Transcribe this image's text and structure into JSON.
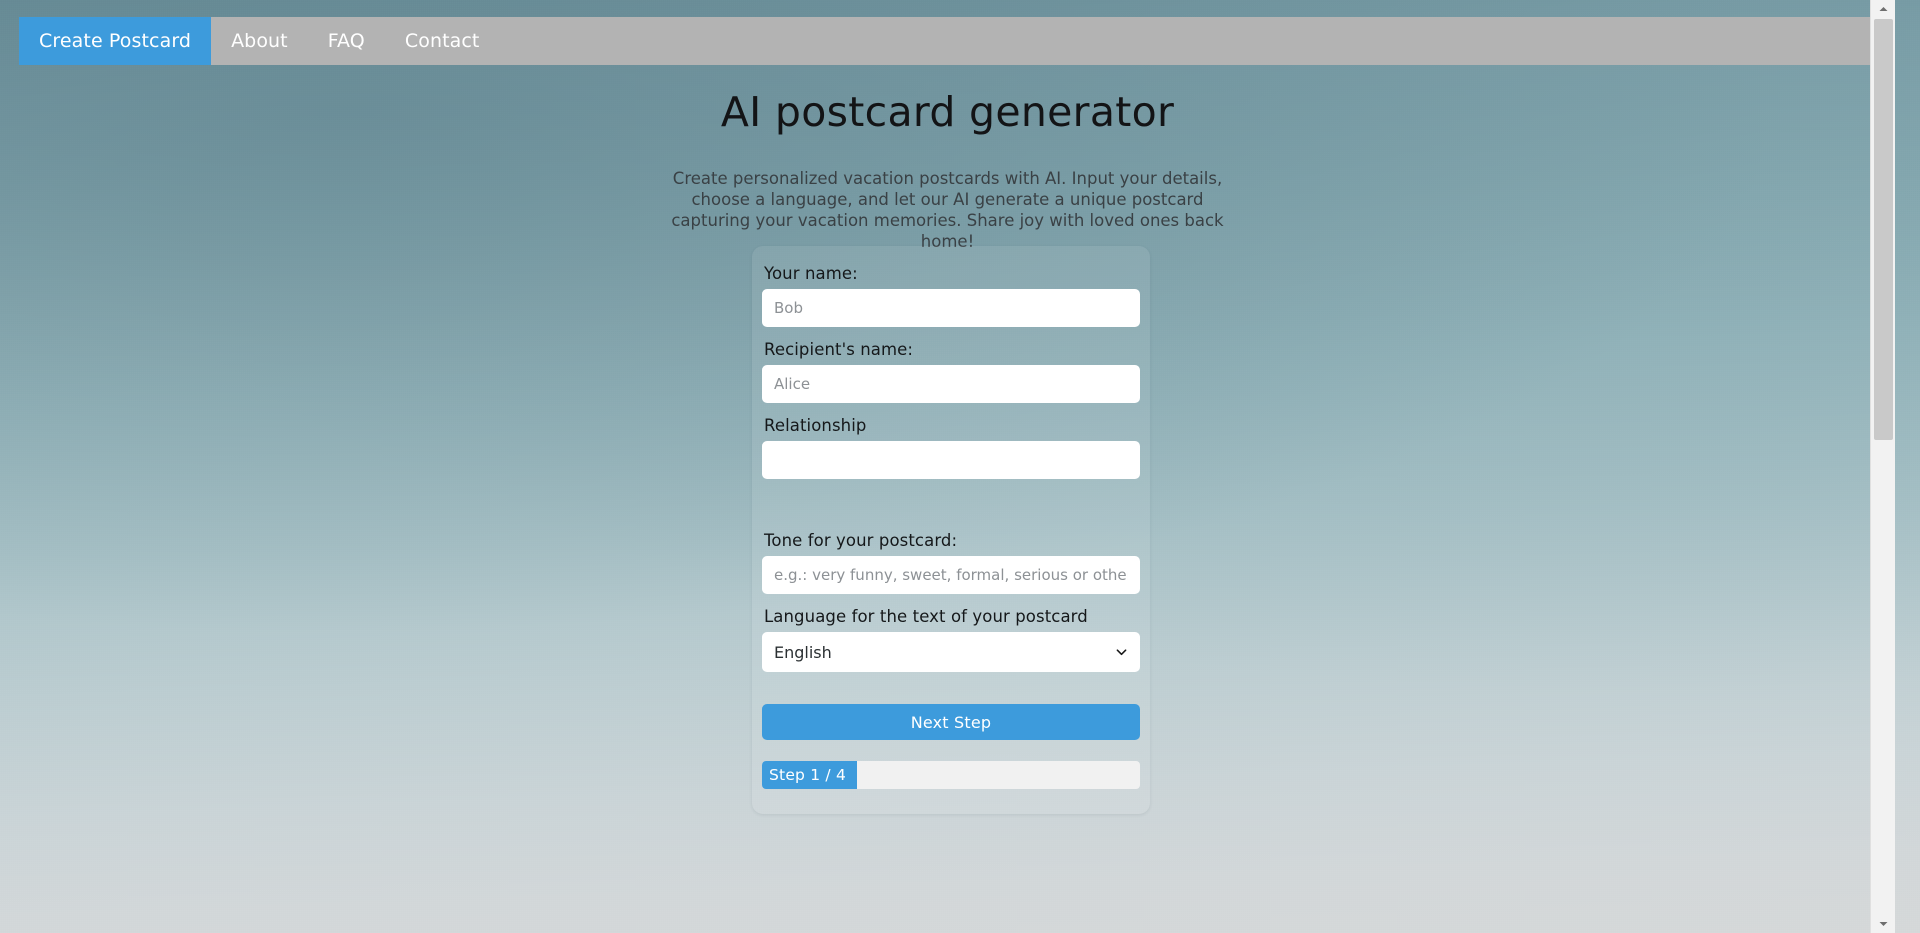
{
  "nav": {
    "items": [
      {
        "label": "Create Postcard",
        "active": true
      },
      {
        "label": "About",
        "active": false
      },
      {
        "label": "FAQ",
        "active": false
      },
      {
        "label": "Contact",
        "active": false
      }
    ]
  },
  "hero": {
    "title": "AI postcard generator",
    "subtitle": "Create personalized vacation postcards with AI. Input your details, choose a language, and let our AI generate a unique postcard capturing your vacation memories. Share joy with loved ones back home!"
  },
  "form": {
    "your_name": {
      "label": "Your name:",
      "value": "",
      "placeholder": "Bob"
    },
    "recipient_name": {
      "label": "Recipient's name:",
      "value": "",
      "placeholder": "Alice"
    },
    "relationship": {
      "label": "Relationship",
      "value": "",
      "placeholder": ""
    },
    "tone": {
      "label": "Tone for your postcard:",
      "value": "",
      "placeholder": "e.g.: very funny, sweet, formal, serious or others"
    },
    "language": {
      "label": "Language for the text of your postcard",
      "selected": "English",
      "icon": "chevron-down-icon"
    },
    "submit": {
      "label": "Next Step"
    },
    "progress": {
      "label": "Step 1 / 4",
      "current": 1,
      "total": 4,
      "percent": 25
    }
  },
  "scrollbar": {
    "up_icon": "scroll-up-arrow-icon",
    "down_icon": "scroll-down-arrow-icon"
  },
  "colors": {
    "accent": "#3d9bdc",
    "navbar": "#b3b3b3",
    "progress_track": "#f1f1f1",
    "input_bg": "#ffffff",
    "title_text": "#131416"
  }
}
